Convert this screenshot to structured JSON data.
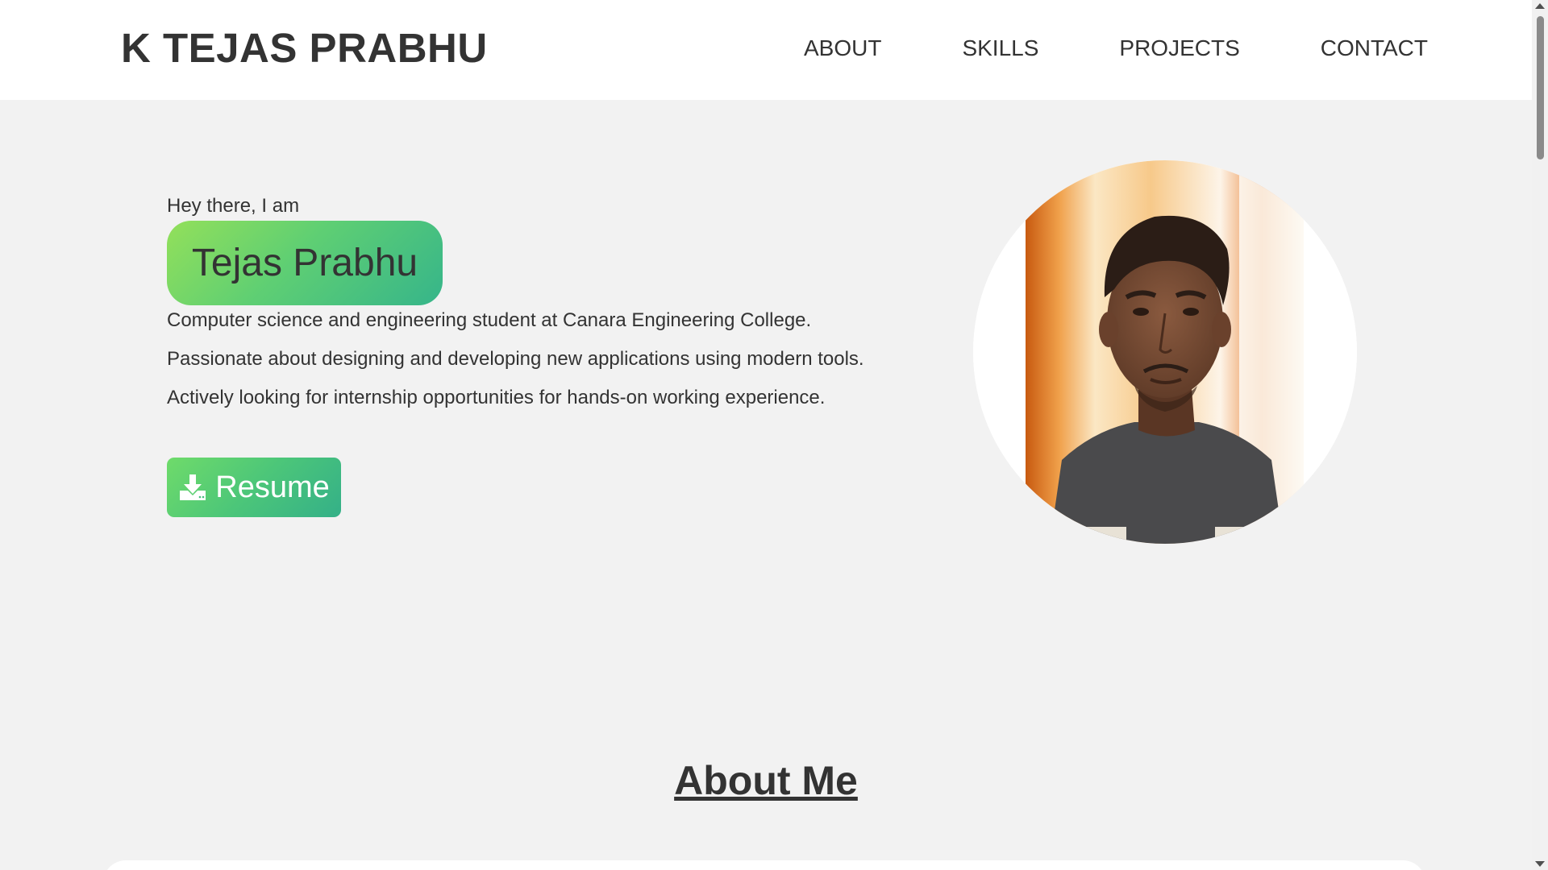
{
  "header": {
    "brand": "K TEJAS PRABHU",
    "nav": [
      {
        "label": "ABOUT"
      },
      {
        "label": "SKILLS"
      },
      {
        "label": "PROJECTS"
      },
      {
        "label": "CONTACT"
      }
    ]
  },
  "hero": {
    "greeting": "Hey there, I am",
    "name": "Tejas Prabhu",
    "lines": [
      "Computer science and engineering student at Canara Engineering College.",
      "Passionate about designing and developing new applications using modern tools.",
      "Actively looking for internship opportunities for hands-on working experience."
    ],
    "resume_label": "Resume",
    "resume_icon": "download-icon",
    "avatar_icon": "profile-photo"
  },
  "about": {
    "title": "About Me"
  },
  "colors": {
    "accent_start": "#93e05a",
    "accent_end": "#36b58a",
    "text": "#333333",
    "page_bg": "#f2f2f2",
    "header_bg": "#ffffff"
  }
}
